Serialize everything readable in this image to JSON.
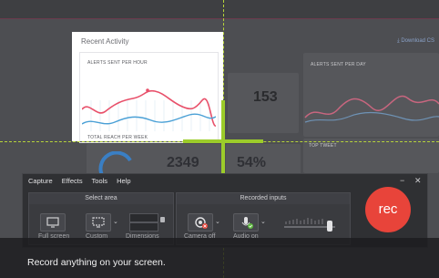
{
  "colors": {
    "selection_guide": "#b7d43a",
    "record_button": "#e8443a",
    "toolbar_bg": "#2f3033",
    "line_chart_red": "#e8506a",
    "line_chart_blue": "#4aa0d6"
  },
  "dashboard": {
    "download_link": "Download CS",
    "alerts_per_day": "ALERTS SENT PER DAY",
    "metric_153": "153",
    "metric_2349": "2349",
    "metric_54": "54%",
    "top_tweet": "TOP TWEET"
  },
  "recent_activity": {
    "title": "Recent Activity",
    "alerts_per_hour": "ALERTS SENT PER HOUR",
    "total_reach": "TOTAL REACH PER WEEK"
  },
  "recorder": {
    "menu": [
      "Capture",
      "Effects",
      "Tools",
      "Help"
    ],
    "minimize": "−",
    "close": "✕",
    "select_area": {
      "title": "Select area",
      "full_screen": "Full screen",
      "custom": "Custom",
      "dimensions": "Dimensions"
    },
    "recorded_inputs": {
      "title": "Recorded inputs",
      "camera": "Camera off",
      "audio": "Audio on"
    },
    "rec_label": "rec"
  },
  "caption": {
    "text": "Record anything on your screen."
  }
}
